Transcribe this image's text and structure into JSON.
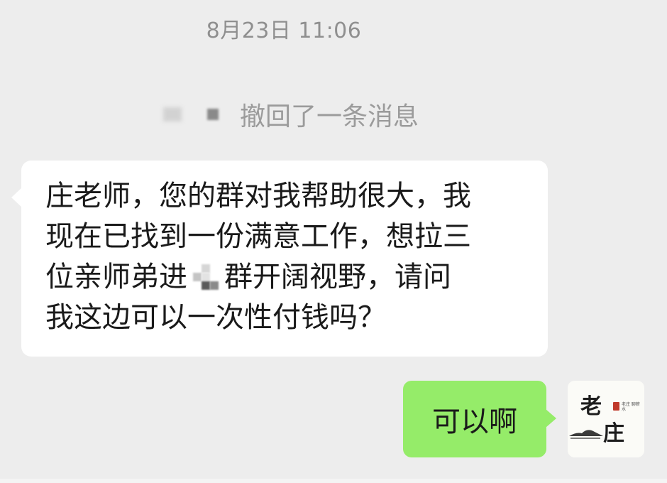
{
  "timestamp": "8月23日 11:06",
  "recall_notice": "撤回了一条消息",
  "incoming_message": {
    "line1": "庄老师，您的群对我帮助很大，我",
    "line2": "现在已找到一份满意工作，想拉三",
    "line3_before": "位亲师弟进",
    "line3_after": "群开阔视野，请问",
    "line4": "我这边可以一次性付钱吗？"
  },
  "outgoing_message": "可以啊",
  "avatar": {
    "char_top": "老",
    "char_bottom": "庄",
    "small_caption": "老庄 聊薪水"
  },
  "colors": {
    "background": "#ededed",
    "incoming_bubble": "#ffffff",
    "outgoing_bubble": "#95ec69",
    "timestamp_text": "#8f8f8f",
    "system_text": "#9b9b9b",
    "message_text": "#1a1a1a"
  }
}
